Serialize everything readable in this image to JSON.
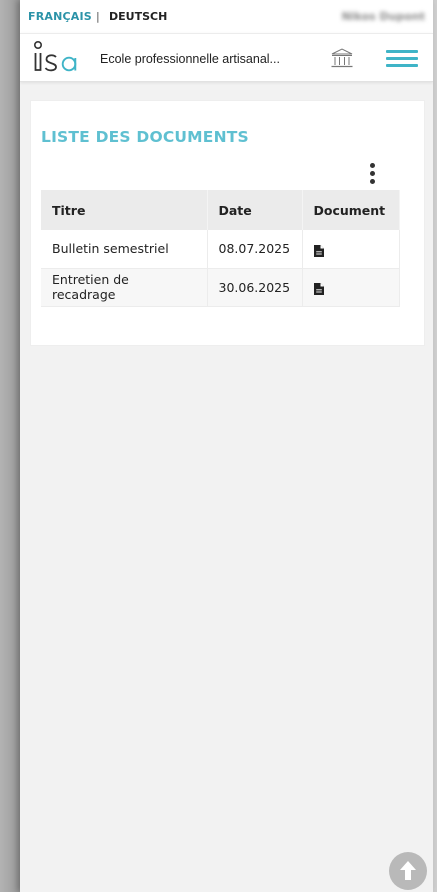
{
  "language_bar": {
    "french_label": "FRANÇAIS",
    "separator": "|",
    "german_label": "DEUTSCH",
    "user_name": "Nikos Dupont"
  },
  "header": {
    "logo_text": "isa",
    "school_name": "Ecole professionnelle artisanal...",
    "building_icon": "institution-icon",
    "menu_icon": "hamburger-menu-icon"
  },
  "documents": {
    "title": "LISTE DES DOCUMENTS",
    "options_icon": "kebab-vertical-icon",
    "columns": [
      "Titre",
      "Date",
      "Document"
    ],
    "rows": [
      {
        "title": "Bulletin semestriel",
        "date": "08.07.2025",
        "document_icon": "file-icon"
      },
      {
        "title": "Entretien de recadrage",
        "date": "30.06.2025",
        "document_icon": "file-icon"
      }
    ]
  },
  "scroll_top_icon": "arrow-up-circle-icon",
  "colors": {
    "accent": "#3fb4c7",
    "title": "#5fc0d1",
    "language_active": "#2c93a8"
  }
}
